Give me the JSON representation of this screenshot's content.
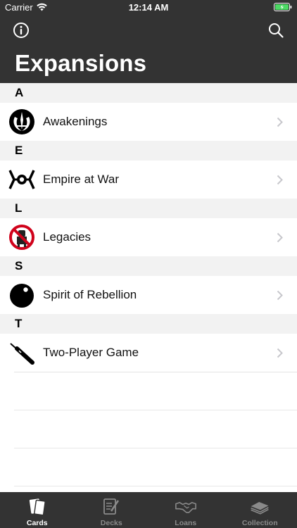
{
  "status_bar": {
    "carrier": "Carrier",
    "time": "12:14 AM"
  },
  "header": {
    "title": "Expansions"
  },
  "sections": [
    {
      "letter": "A",
      "items": [
        {
          "label": "Awakenings",
          "icon": "jedi-order-icon"
        }
      ]
    },
    {
      "letter": "E",
      "items": [
        {
          "label": "Empire at War",
          "icon": "tie-fighter-icon"
        }
      ]
    },
    {
      "letter": "L",
      "items": [
        {
          "label": "Legacies",
          "icon": "no-droids-icon"
        }
      ]
    },
    {
      "letter": "S",
      "items": [
        {
          "label": "Spirit of Rebellion",
          "icon": "death-star-icon"
        }
      ]
    },
    {
      "letter": "T",
      "items": [
        {
          "label": "Two-Player Game",
          "icon": "lightsaber-icon"
        }
      ]
    }
  ],
  "tabs": [
    {
      "label": "Cards",
      "icon": "cards-icon",
      "active": true
    },
    {
      "label": "Decks",
      "icon": "decks-icon",
      "active": false
    },
    {
      "label": "Loans",
      "icon": "handshake-icon",
      "active": false
    },
    {
      "label": "Collection",
      "icon": "collection-icon",
      "active": false
    }
  ],
  "colors": {
    "header_bg": "#333333",
    "section_bg": "#f2f2f2",
    "accent_green": "#4cd964",
    "warning_red": "#d0021b"
  }
}
